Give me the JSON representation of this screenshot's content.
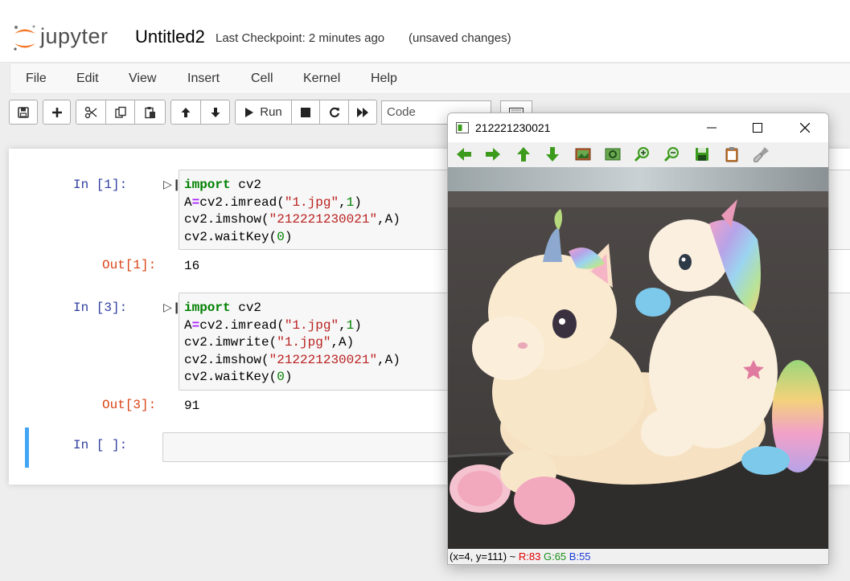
{
  "header": {
    "logo_text": "jupyter",
    "notebook_name": "Untitled2",
    "checkpoint": "Last Checkpoint: 2 minutes ago",
    "unsaved": "(unsaved changes)"
  },
  "menu": [
    "File",
    "Edit",
    "View",
    "Insert",
    "Cell",
    "Kernel",
    "Help"
  ],
  "toolbar": {
    "run_label": "Run",
    "cell_type": "Code",
    "icons": [
      "save-icon",
      "plus-icon",
      "cut-icon",
      "copy-icon",
      "paste-icon",
      "arrow-up-icon",
      "arrow-down-icon",
      "run-icon",
      "stop-icon",
      "restart-icon",
      "fast-forward-icon",
      "keyboard-icon"
    ]
  },
  "cells": [
    {
      "in_prompt": "In [1]:",
      "out_prompt": "Out[1]:",
      "output": "16",
      "lines": [
        [
          {
            "t": "import",
            "c": "kw"
          },
          {
            "t": " cv2",
            "c": ""
          }
        ],
        [
          {
            "t": "A",
            "c": ""
          },
          {
            "t": "=",
            "c": "op"
          },
          {
            "t": "cv2.imread(",
            "c": ""
          },
          {
            "t": "\"1.jpg\"",
            "c": "str"
          },
          {
            "t": ",",
            "c": ""
          },
          {
            "t": "1",
            "c": "num"
          },
          {
            "t": ")",
            "c": ""
          }
        ],
        [
          {
            "t": "cv2.imshow(",
            "c": ""
          },
          {
            "t": "\"212221230021\"",
            "c": "str"
          },
          {
            "t": ",A)",
            "c": ""
          }
        ],
        [
          {
            "t": "cv2.waitKey(",
            "c": ""
          },
          {
            "t": "0",
            "c": "num"
          },
          {
            "t": ")",
            "c": ""
          }
        ]
      ]
    },
    {
      "in_prompt": "In [3]:",
      "out_prompt": "Out[3]:",
      "output": "91",
      "lines": [
        [
          {
            "t": "import",
            "c": "kw"
          },
          {
            "t": " cv2",
            "c": ""
          }
        ],
        [
          {
            "t": "A",
            "c": ""
          },
          {
            "t": "=",
            "c": "op"
          },
          {
            "t": "cv2.imread(",
            "c": ""
          },
          {
            "t": "\"1.jpg\"",
            "c": "str"
          },
          {
            "t": ",",
            "c": ""
          },
          {
            "t": "1",
            "c": "num"
          },
          {
            "t": ")",
            "c": ""
          }
        ],
        [
          {
            "t": "cv2.imwrite(",
            "c": ""
          },
          {
            "t": "\"1.jpg\"",
            "c": "str"
          },
          {
            "t": ",A)",
            "c": ""
          }
        ],
        [
          {
            "t": "cv2.imshow(",
            "c": ""
          },
          {
            "t": "\"212221230021\"",
            "c": "str"
          },
          {
            "t": ",A)",
            "c": ""
          }
        ],
        [
          {
            "t": "cv2.waitKey(",
            "c": ""
          },
          {
            "t": "0",
            "c": "num"
          },
          {
            "t": ")",
            "c": ""
          }
        ]
      ]
    },
    {
      "in_prompt": "In [ ]:"
    }
  ],
  "cv_window": {
    "title": "212221230021",
    "status_pos": "(x=4, y=111) ~ ",
    "status_r": "R:83",
    "status_g": "G:65",
    "status_b": "B:55",
    "tools": [
      "pan-left-icon",
      "pan-right-icon",
      "pan-up-icon",
      "pan-down-icon",
      "zoom-fit-icon",
      "zoom-original-icon",
      "zoom-in-icon",
      "zoom-out-icon",
      "save-image-icon",
      "copy-clipboard-icon",
      "properties-icon"
    ]
  },
  "colors": {
    "prompt_in": "#303f9f",
    "prompt_out": "#d84315",
    "selected_cell": "#42a5f5",
    "cv_green": "#3c9b1c"
  }
}
